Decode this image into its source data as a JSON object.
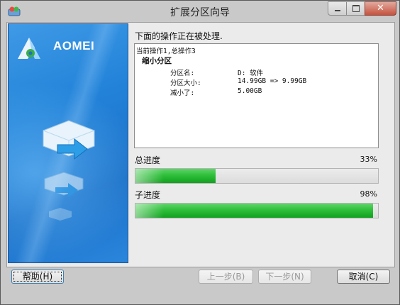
{
  "window": {
    "title": "扩展分区向导",
    "close_glyph": "✕"
  },
  "sidebar": {
    "brand": "AOMEI"
  },
  "operation": {
    "heading": "下面的操作正在被处理.",
    "current": "当前操作1,总操作3",
    "action": "缩小分区",
    "rows": [
      {
        "label": "分区名:",
        "value": "D: 软件"
      },
      {
        "label": "分区大小:",
        "value": "14.99GB => 9.99GB"
      },
      {
        "label": "减小了:",
        "value": "5.00GB"
      }
    ]
  },
  "progress": {
    "total": {
      "label": "总进度",
      "percent_text": "33%",
      "value": 0.33
    },
    "sub": {
      "label": "子进度",
      "percent_text": "98%",
      "value": 0.98
    }
  },
  "buttons": {
    "help": "帮助(H)",
    "prev": "上一步(B)",
    "next": "下一步(N)",
    "cancel": "取消(C)"
  }
}
